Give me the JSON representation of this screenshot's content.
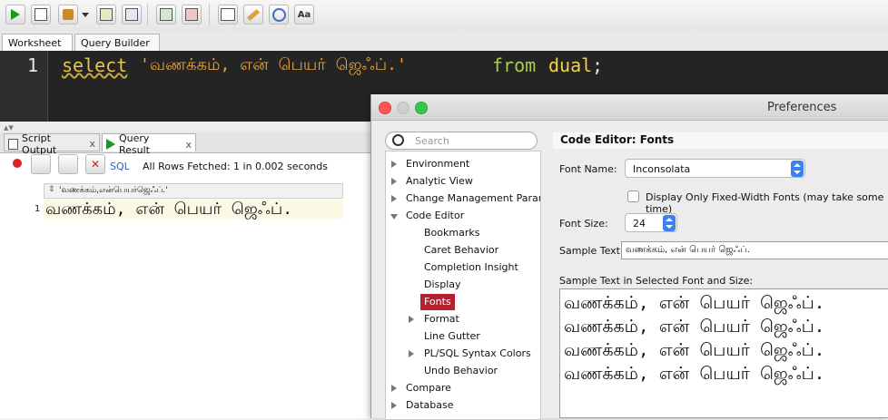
{
  "toolbar": {
    "buttons": [
      "run-statement-icon",
      "run-script-icon",
      "commit-icon",
      "rollback-icon",
      "explain-plan-icon",
      "autotrace-icon",
      "sql-tuning-icon",
      "clear-icon",
      "history-icon",
      "format-icon"
    ]
  },
  "worksheet": {
    "tabs": [
      "Worksheet",
      "Query Builder"
    ],
    "line_number": "1",
    "code_keyword": "select",
    "code_string": "'வணக்கம், என் பெயர் ஜெஃப்.'",
    "code_from": "from",
    "code_table": "dual",
    "code_semicolon": ";"
  },
  "output": {
    "tab_script": "Script Output",
    "tab_result": "Query Result",
    "close_x": "x",
    "sql_label": "SQL",
    "status": "All Rows Fetched: 1 in 0.002 seconds",
    "column_header": "'வணக்கம்,என்பெயர்ஜெஃப்.'",
    "row_number": "1",
    "row_value": "வணக்கம், என் பெயர் ஜெஃப்."
  },
  "preferences": {
    "title": "Preferences",
    "search_placeholder": "Search",
    "tree": {
      "environment": "Environment",
      "analytic_view": "Analytic View",
      "change_mgmt": "Change Management Paramete",
      "code_editor": "Code Editor",
      "bookmarks": "Bookmarks",
      "caret_behavior": "Caret Behavior",
      "completion_insight": "Completion Insight",
      "display": "Display",
      "fonts": "Fonts",
      "format": "Format",
      "line_gutter": "Line Gutter",
      "plsql_colors": "PL/SQL Syntax Colors",
      "undo_behavior": "Undo Behavior",
      "compare": "Compare",
      "database": "Database"
    },
    "section_title": "Code Editor: Fonts",
    "font_name_label": "Font Name:",
    "font_name_value": "Inconsolata",
    "fixed_width_label": "Display Only Fixed-Width Fonts (may take some time)",
    "font_size_label": "Font Size:",
    "font_size_value": "24",
    "sample_text_label": "Sample Text:",
    "sample_text_value": "வணக்கம், என் பெயர் ஜெஃப்.",
    "sample_area_label": "Sample Text in Selected Font and Size:",
    "sample_lines": [
      "வணக்கம், என் பெயர் ஜெஃப்.",
      "வணக்கம், என் பெயர் ஜெஃப்.",
      "வணக்கம், என் பெயர் ஜெஃப்.",
      "வணக்கம், என் பெயர் ஜெஃப்."
    ]
  },
  "colors": {
    "keyword": "#e8c547",
    "string": "#e8a13a",
    "from_kw": "#a6cf54",
    "fonts_selected": "#b5212f"
  }
}
